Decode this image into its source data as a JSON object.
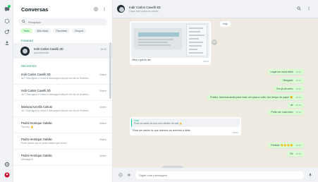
{
  "sidebar": {
    "title": "Conversas",
    "search_placeholder": "Pesquisar",
    "filters": [
      {
        "label": "Tudo",
        "active": true
      },
      {
        "label": "Não lidas",
        "active": false
      },
      {
        "label": "Favoritas",
        "active": false
      },
      {
        "label": "Grupos",
        "active": false
      }
    ],
    "pinned_label": "FIXADAS",
    "pinned": {
      "name": "Indir Carlos Cavelli 3D",
      "preview": "Ignore/inscrito",
      "time": "08:40"
    },
    "recent_label": "RECENTES",
    "chats": [
      {
        "name": "Indir Carlos Cavelli 3D",
        "preview": "ok? Olha agora e envia a mensagem depois me diz se recebeu...",
        "time": "Ontem"
      },
      {
        "name": "Indir Carlos Cavelli 3D",
        "preview": "ok? Olha agora e envia a mensagem depois me diz se recebeu...",
        "time": "Ontem"
      },
      {
        "name": "Mariana Kervllis Cultura",
        "preview": "ok? Olha agora e envia a mensagem depois me diz se recebeu...",
        "time": "Ontem"
      },
      {
        "name": "Pedro Henrique Galvão",
        "preview": "Ta certo 👍",
        "time": "Ontem"
      },
      {
        "name": "Pedro Henrique Galvão",
        "preview": "Pode deixar que eu aviso assim que entrar...",
        "time": "Ontem"
      },
      {
        "name": "Pedro Henrique Galvão",
        "preview": "Mensagem",
        "time": "Ontem"
      }
    ]
  },
  "chat": {
    "name": "Indir Carlos Cavelli 3D",
    "subtitle": "Clique para dados do contato",
    "date_pill": "Hoje",
    "image_caption": "Olha o que fiz daí",
    "image_time": "08:31",
    "outgoing": [
      {
        "text": "Legal ver essa ideia",
        "time": "08:32"
      },
      {
        "text": "Obrigado",
        "time": "08:32"
      },
      {
        "text": "Sim já dá certo",
        "time": "08:32"
      },
      {
        "text": "Prático, teremos ainda para mais um para a volta. Um tempo de papel 😊",
        "time": "08:33"
      },
      {
        "text": "ok",
        "time": "08:33"
      },
      {
        "text": "Pode ver, tudo bem",
        "time": "08:33"
      }
    ],
    "quote": {
      "author": "Você",
      "text": "Pode ser assim do que outro detalhe de vale 👍",
      "body": "Pode ser assim do que faremos ao terminar a ideia",
      "time": "08:34"
    },
    "late_outgoing": [
      {
        "text": "Perfeito 👏👏👏👏",
        "time": "08:35"
      },
      {
        "text": "Ok",
        "time": "08:35"
      }
    ],
    "composer_placeholder": "Digite uma mensagem"
  },
  "colors": {
    "accent": "#008069",
    "outgoing": "#d9fdd3",
    "chat_bg": "#efeae2"
  }
}
